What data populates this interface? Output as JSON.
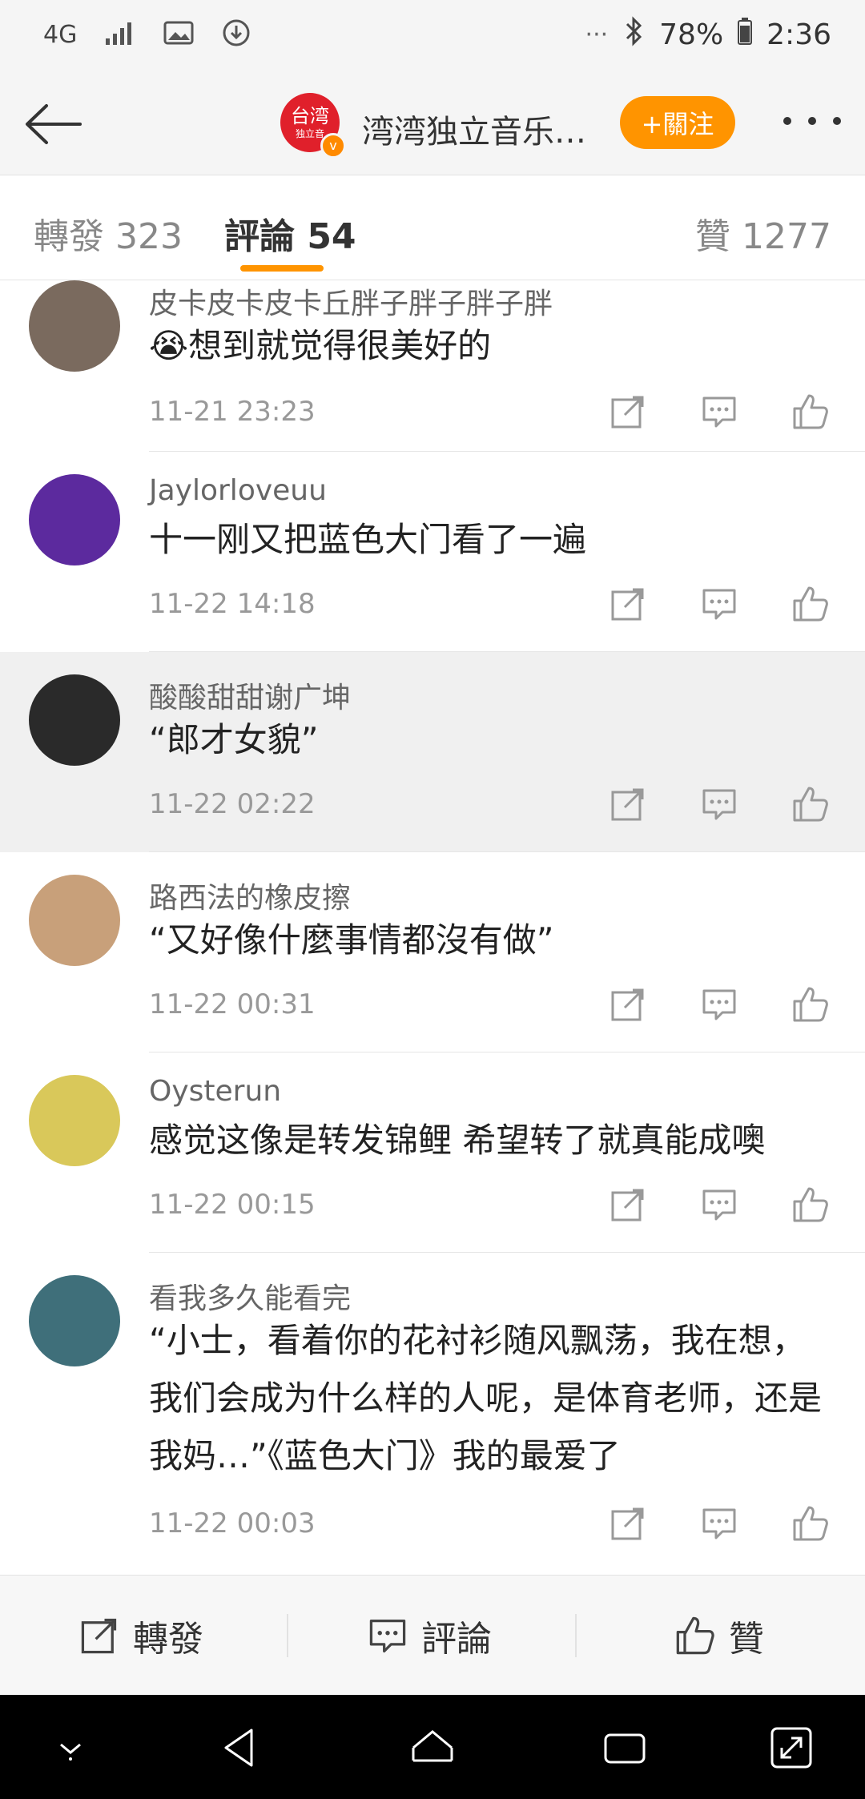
{
  "status_bar": {
    "network": "4G",
    "battery": "78%",
    "time": "2:36",
    "dots": "···"
  },
  "header": {
    "avatar_text": "台湾",
    "avatar_sub": "独立音",
    "title": "湾湾独立音乐…",
    "follow_label": "+關注"
  },
  "tabs": [
    {
      "label": "轉發 323"
    },
    {
      "label": "評論 54"
    },
    {
      "label": "贊 1277"
    }
  ],
  "comments": [
    {
      "name": "皮卡皮卡皮卡丘胖子胖子胖子胖",
      "text": "😭想到就觉得很美好的",
      "time": "11-21 23:23",
      "avatar_color": "#7a6a5e"
    },
    {
      "name": "Jaylorloveuu",
      "text": "十一刚又把蓝色大门看了一遍",
      "time": "11-22 14:18",
      "avatar_color": "#5c2a9e"
    },
    {
      "name": "酸酸甜甜谢广坤",
      "text": "“郎才女貌”",
      "time": "11-22 02:22",
      "avatar_color": "#2a2a2a"
    },
    {
      "name": "路西法的橡皮擦",
      "text": "“又好像什麼事情都沒有做”",
      "time": "11-22 00:31",
      "avatar_color": "#c8a07a"
    },
    {
      "name": "Oysterun",
      "text": "感觉这像是转发锦鲤  希望转了就真能成噢",
      "time": "11-22 00:15",
      "avatar_color": "#d9c85a"
    },
    {
      "name": "看我多久能看完",
      "text": "“小士，看着你的花衬衫随风飘荡，我在想，我们会成为什么样的人呢，是体育老师，还是我妈…”《蓝色大门》我的最爱了",
      "time": "11-22 00:03",
      "avatar_color": "#3f6f7a"
    }
  ],
  "bottom_actions": {
    "repost": "轉發",
    "comment": "評論",
    "like": "贊"
  },
  "colors": {
    "accent": "#ff9400",
    "brand_red": "#e0202b"
  }
}
